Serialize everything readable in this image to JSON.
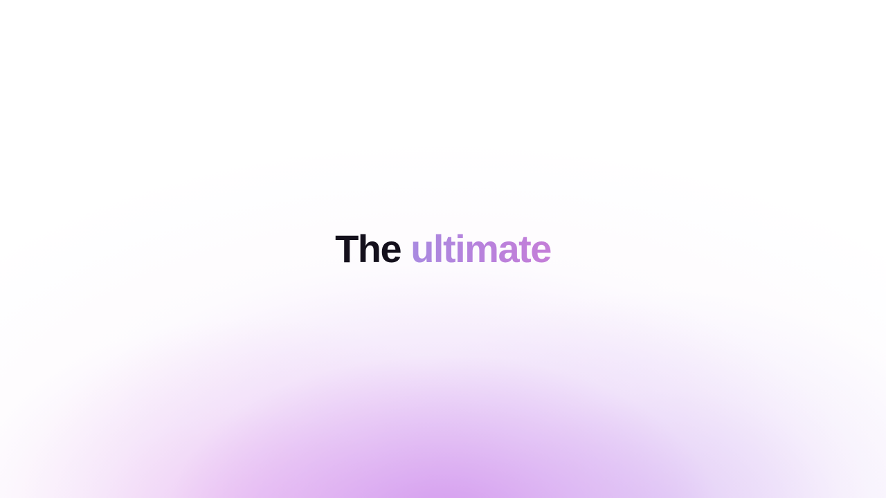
{
  "hero": {
    "headline_word_1": "The",
    "headline_word_2": "ultimate"
  },
  "colors": {
    "background": "#ffffff",
    "headline_dark": "#14101c",
    "headline_accent_start": "#a98ae0",
    "headline_accent_end": "#c47ed8",
    "glow_purple": "#ce8cec"
  }
}
